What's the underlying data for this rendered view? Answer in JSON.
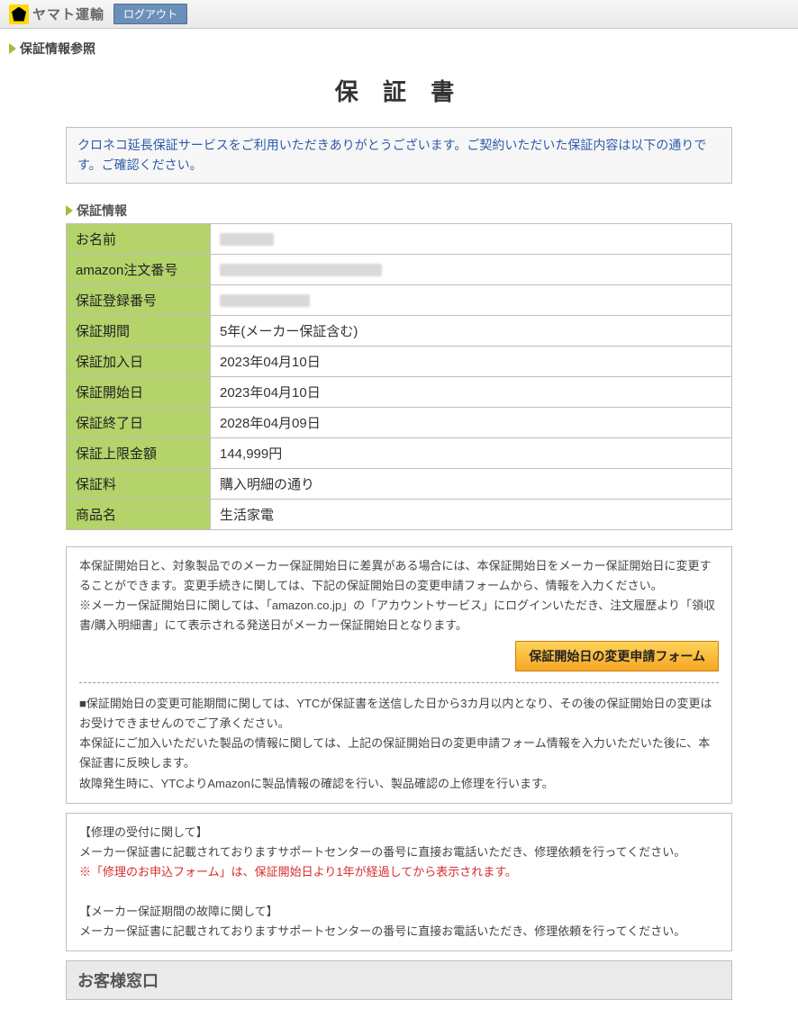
{
  "topbar": {
    "brand": "ヤマト運輸",
    "logout_label": "ログアウト"
  },
  "crumb": {
    "title": "保証情報参照"
  },
  "doc": {
    "title": "保 証 書",
    "intro": "クロネコ延長保証サービスをご利用いただきありがとうございます。ご契約いただいた保証内容は以下の通りです。ご確認ください。"
  },
  "section": {
    "info_head": "保証情報",
    "support_head": "お客様窓口"
  },
  "rows": {
    "name_label": "お名前",
    "order_label": "amazon注文番号",
    "reg_label": "保証登録番号",
    "period_label": "保証期間",
    "period_value": "5年(メーカー保証含む)",
    "join_label": "保証加入日",
    "join_value": "2023年04月10日",
    "start_label": "保証開始日",
    "start_value": "2023年04月10日",
    "end_label": "保証終了日",
    "end_value": "2028年04月09日",
    "limit_label": "保証上限金額",
    "limit_value": "144,999円",
    "fee_label": "保証料",
    "fee_value": "購入明細の通り",
    "product_label": "商品名",
    "product_value": "生活家電"
  },
  "box1": {
    "p1": "本保証開始日と、対象製品でのメーカー保証開始日に差異がある場合には、本保証開始日をメーカー保証開始日に変更することができます。変更手続きに関しては、下記の保証開始日の変更申請フォームから、情報を入力ください。",
    "p2": "※メーカー保証開始日に関しては、「amazon.co.jp」の「アカウントサービス」にログインいただき、注文履歴より「領収書/購入明細書」にて表示される発送日がメーカー保証開始日となります。",
    "button": "保証開始日の変更申請フォーム",
    "p3": "■保証開始日の変更可能期間に関しては、YTCが保証書を送信した日から3カ月以内となり、その後の保証開始日の変更はお受けできませんのでご了承ください。",
    "p4": "本保証にご加入いただいた製品の情報に関しては、上記の保証開始日の変更申請フォーム情報を入力いただいた後に、本保証書に反映します。",
    "p5": "故障発生時に、YTCよりAmazonに製品情報の確認を行い、製品確認の上修理を行います。"
  },
  "box2": {
    "h1": "【修理の受付に関して】",
    "p1": "メーカー保証書に記載されておりますサポートセンターの番号に直接お電話いただき、修理依頼を行ってください。",
    "p2": "※「修理のお申込フォーム」は、保証開始日より1年が経過してから表示されます。",
    "h2": "【メーカー保証期間の故障に関して】",
    "p3": "メーカー保証書に記載されておりますサポートセンターの番号に直接お電話いただき、修理依頼を行ってください。"
  }
}
